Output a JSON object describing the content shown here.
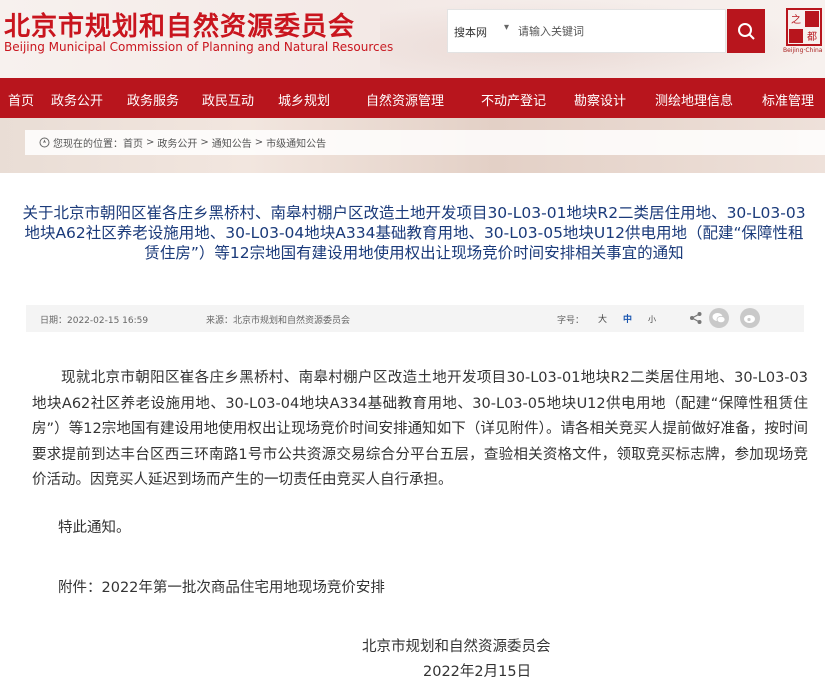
{
  "header": {
    "title_cn": "北京市规划和自然资源委员会",
    "title_en": "Beijing Municipal Commission of Planning and Natural Resources",
    "search_scope": "搜本网",
    "search_placeholder": "请输入关键词",
    "seal_caption": "Beijing·China"
  },
  "nav": {
    "items": [
      "首页",
      "政务公开",
      "政务服务",
      "政民互动",
      "城乡规划",
      "自然资源管理",
      "不动产登记",
      "勘察设计",
      "测绘地理信息",
      "标准管理"
    ]
  },
  "breadcrumb": {
    "prefix": "您现在的位置：",
    "items": [
      "首页",
      "政务公开",
      "通知公告",
      "市级通知公告"
    ],
    "separator": ">"
  },
  "article": {
    "title": "关于北京市朝阳区崔各庄乡黑桥村、南皋村棚户区改造土地开发项目30-L03-01地块R2二类居住用地、30-L03-03地块A62社区养老设施用地、30-L03-04地块A334基础教育用地、30-L03-05地块U12供电用地（配建“保障性租赁住房”）等12宗地国有建设用地使用权出让现场竞价时间安排相关事宜的通知",
    "date": "日期：2022-02-15 16:59",
    "source": "来源：北京市规划和自然资源委员会",
    "font_size_label": "字号：",
    "font_sizes": [
      "大",
      "中",
      "小"
    ],
    "body": "现就北京市朝阳区崔各庄乡黑桥村、南皋村棚户区改造土地开发项目30-L03-01地块R2二类居住用地、30-L03-03地块A62社区养老设施用地、30-L03-04地块A334基础教育用地、30-L03-05地块U12供电用地（配建“保障性租赁住房”）等12宗地国有建设用地使用权出让现场竞价时间安排通知如下（详见附件）。请各相关竞买人提前做好准备，按时间要求提前到达丰台区西三环南路1号市公共资源交易综合分平台五层，查验相关资格文件，领取竞买标志牌，参加现场竞价活动。因竞买人延迟到场而产生的一切责任由竞买人自行承担。",
    "closing": "特此通知。",
    "attachment": "附件：2022年第一批次商品住宅用地现场竞价安排",
    "signature_org": "北京市规划和自然资源委员会",
    "signature_date": "2022年2月15日"
  },
  "colors": {
    "brand_red": "#b8151d",
    "title_blue": "#1a3a7a",
    "active_font_blue": "#1a56b0"
  }
}
